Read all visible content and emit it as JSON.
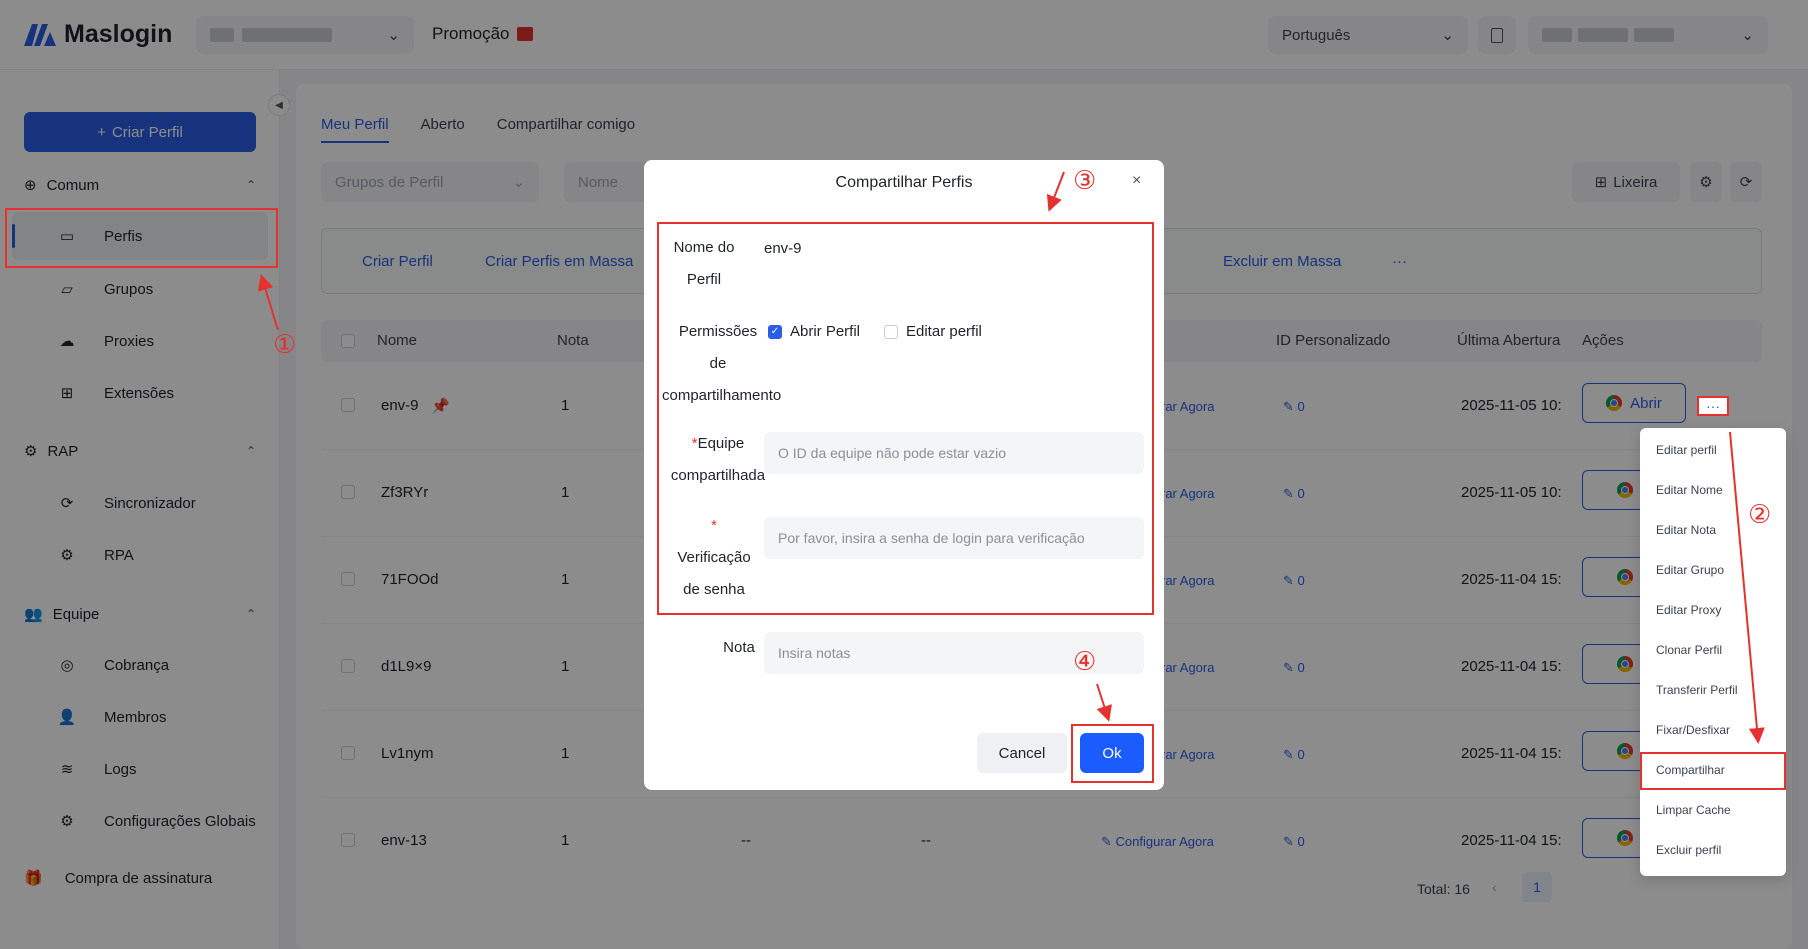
{
  "header": {
    "brand": "Maslogin",
    "promo": "Promoção",
    "language": "Português"
  },
  "sidebar": {
    "create_profile": "Criar Perfil",
    "sections": [
      {
        "label": "Comum",
        "items": [
          "Perfis",
          "Grupos",
          "Proxies",
          "Extensões"
        ]
      },
      {
        "label": "RAP",
        "items": [
          "Sincronizador",
          "RPA"
        ]
      },
      {
        "label": "Equipe",
        "items": [
          "Cobrança",
          "Membros",
          "Logs",
          "Configurações Globais"
        ]
      }
    ],
    "subscription": "Compra de assinatura"
  },
  "main": {
    "tabs": [
      "Meu Perfil",
      "Aberto",
      "Compartilhar comigo"
    ],
    "filter_group": "Grupos de Perfil",
    "filter_name": "Nome",
    "trash": "Lixeira",
    "actions": [
      "Criar Perfil",
      "Criar Perfis em Massa",
      "Excluir em Massa",
      "···"
    ],
    "columns": [
      "Nome",
      "Nota",
      "ID Personalizado",
      "Última Abertura",
      "Ações"
    ],
    "rows": [
      {
        "name": "env-9",
        "note": "1",
        "proxy": "rar Agora",
        "id": "0",
        "last": "2025-11-05 10:"
      },
      {
        "name": "Zf3RYr",
        "note": "1",
        "proxy": "rar Agora",
        "id": "0",
        "last": "2025-11-05 10:"
      },
      {
        "name": "71FOOd",
        "note": "1",
        "proxy": "rar Agora",
        "id": "0",
        "last": "2025-11-04 15:"
      },
      {
        "name": "d1L9×9",
        "note": "1",
        "proxy": "rar Agora",
        "id": "0",
        "last": "2025-11-04 15:"
      },
      {
        "name": "Lv1nym",
        "note": "1",
        "proxy": "rar Agora",
        "id": "0",
        "last": "2025-11-04 15:"
      },
      {
        "name": "env-13",
        "note": "1",
        "c1": "--",
        "c2": "--",
        "proxy": "Configurar Agora",
        "id": "0",
        "last": "2025-11-04 15:"
      }
    ],
    "open_label": "Abrir",
    "open_short": "A",
    "total": "Total: 16",
    "page": "1"
  },
  "context_menu": [
    "Editar perfil",
    "Editar Nome",
    "Editar Nota",
    "Editar Grupo",
    "Editar Proxy",
    "Clonar Perfil",
    "Transferir Perfil",
    "Fixar/Desfixar",
    "Compartilhar",
    "Limpar Cache",
    "Excluir perfil"
  ],
  "modal": {
    "title": "Compartilhar Perfis",
    "close": "×",
    "profile_name_label_1": "Nome do",
    "profile_name_label_2": "Perfil",
    "profile_name_value": "env-9",
    "perm_label_1": "Permissões",
    "perm_label_2": "de",
    "perm_label_3": "compartilhamento",
    "perm_open": "Abrir Perfil",
    "perm_edit": "Editar perfil",
    "team_label_1": "Equipe",
    "team_label_2": "compartilhada",
    "team_placeholder": "O ID da equipe não pode estar vazio",
    "pwd_label_1": "Verificação",
    "pwd_label_2": "de senha",
    "pwd_placeholder": "Por favor, insira a senha de login para verificação",
    "note_label": "Nota",
    "note_placeholder": "Insira notas",
    "cancel": "Cancel",
    "ok": "Ok",
    "required_mark": "*"
  },
  "annotations": [
    "①",
    "②",
    "③",
    "④"
  ]
}
